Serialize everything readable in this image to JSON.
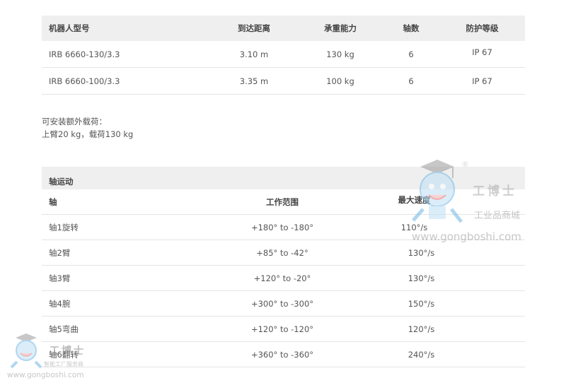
{
  "spec_table": {
    "headers": [
      "机器人型号",
      "到达距离",
      "承重能力",
      "轴数",
      "防护等级"
    ],
    "rows": [
      [
        "IRB 6660-130/3.3",
        "3.10 m",
        "130 kg",
        "6",
        "IP 67"
      ],
      [
        "IRB 6660-100/3.3",
        "3.35 m",
        "100 kg",
        "6",
        "IP 67"
      ]
    ]
  },
  "extra_load": {
    "line1": "可安装额外载荷：",
    "line2": "上臂20 kg，载荷130 kg"
  },
  "axis_table": {
    "section_title": "轴运动",
    "headers": [
      "轴",
      "工作范围",
      "最大速度"
    ],
    "rows": [
      [
        "轴1旋转",
        "+180° to -180°",
        "110°/s"
      ],
      [
        "轴2臂",
        "+85° to -42°",
        "130°/s"
      ],
      [
        "轴3臂",
        "+120° to -20°",
        "130°/s"
      ],
      [
        "轴4腕",
        "+300° to -300°",
        "150°/s"
      ],
      [
        "轴5弯曲",
        "+120° to -120°",
        "120°/s"
      ],
      [
        "轴6翻转",
        "+360° to -360°",
        "240°/s"
      ]
    ]
  },
  "watermark": {
    "brand": "工博士",
    "registered": "®",
    "tagline_center": "工业品商城",
    "url": "www.gongboshi.com",
    "tagline_corner": "智能工厂服务商"
  }
}
